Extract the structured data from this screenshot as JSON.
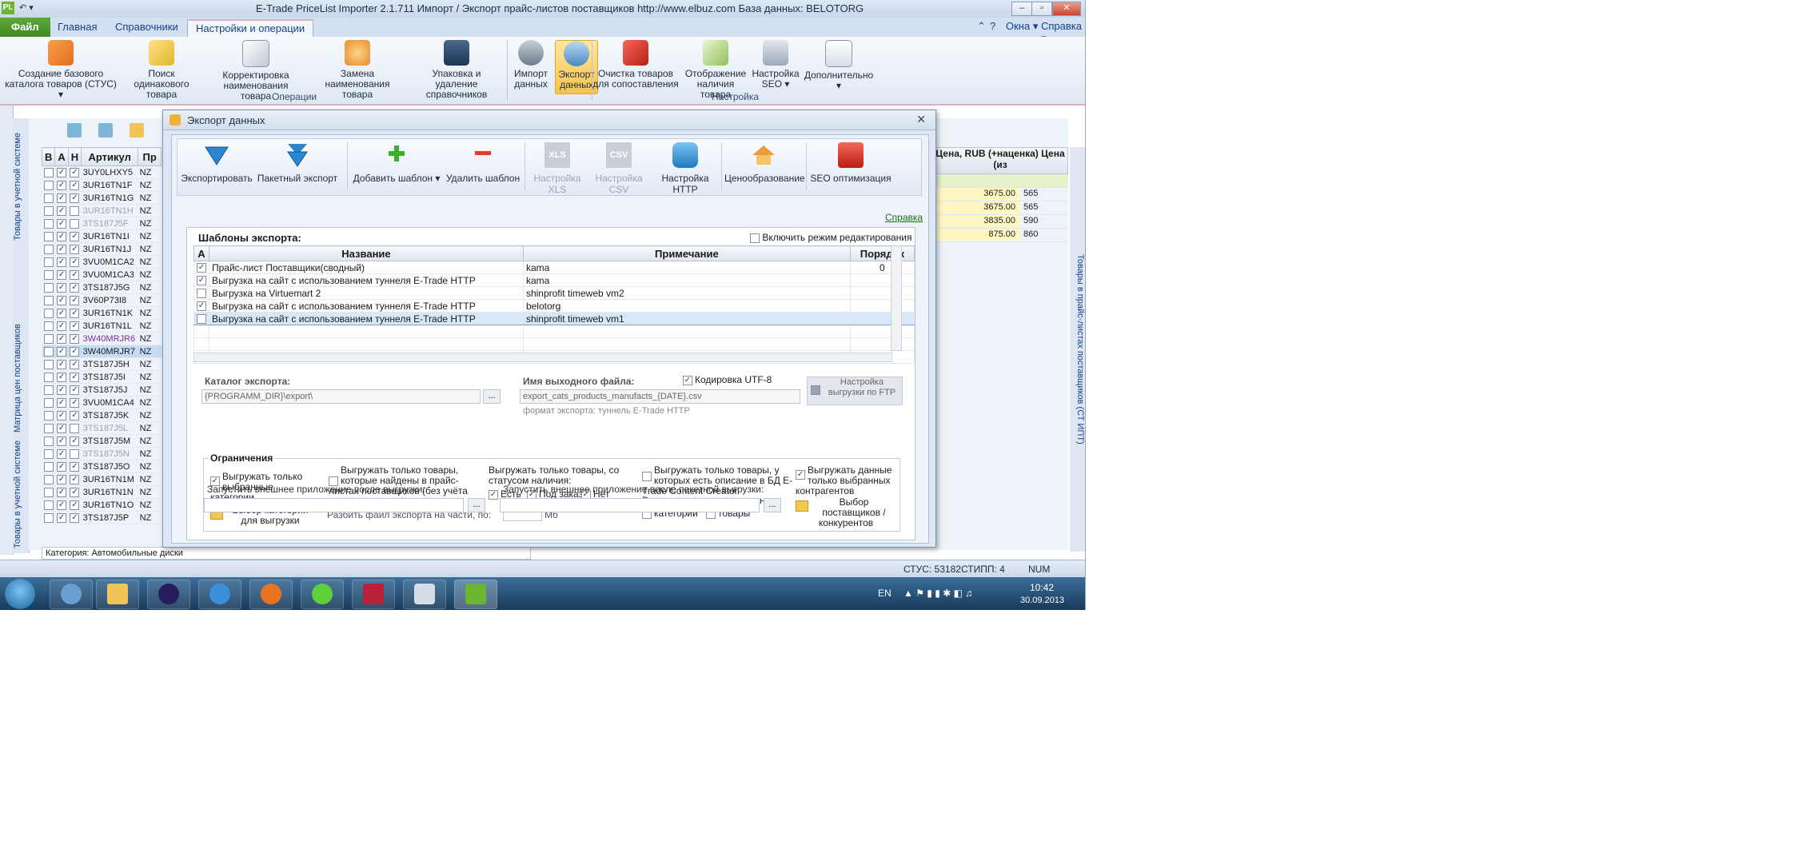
{
  "window": {
    "quick_access": "↶ ▾",
    "title": "E-Trade PriceList Importer 2.1.711   Импорт / Экспорт прайс-листов поставщиков   http://www.elbuz.com   База данных: BELOTORG",
    "min": "–",
    "max": "▫",
    "close": "✕"
  },
  "ribbon_tabs": {
    "file": "Файл",
    "tabs": [
      "Главная",
      "Справочники",
      "Настройки и операции"
    ],
    "windows": "Окна ▾",
    "help": "Справка ▾"
  },
  "ribbon": {
    "buttons": [
      {
        "label": "Создание базового каталога товаров (СТУС) ▾",
        "icon": "cubes-icon"
      },
      {
        "label": "Поиск одинакового товара",
        "icon": "search-product-icon"
      },
      {
        "label": "Корректировка наименования товара",
        "icon": "edit-name-icon"
      },
      {
        "label": "Замена наименования товара",
        "icon": "replace-icon"
      },
      {
        "label": "Упаковка и удаление справочников",
        "icon": "database-pack-icon"
      },
      {
        "label": "Импорт данных",
        "icon": "import-icon"
      },
      {
        "label": "Экспорт данных",
        "icon": "export-icon"
      },
      {
        "label": "Очистка товаров для сопоставления",
        "icon": "clean-icon"
      },
      {
        "label": "Отображение наличия товара",
        "icon": "availability-icon"
      },
      {
        "label": "Настройка SEO ▾",
        "icon": "seo-icon"
      },
      {
        "label": "Дополнительно ▾",
        "icon": "more-icon"
      }
    ],
    "groups": [
      "Операции",
      "Настройка"
    ]
  },
  "vertical_tabs": [
    "Товары в учетной системе",
    "Матрица цен поставщиков",
    "Товары в учетной системе"
  ],
  "right_vertical_tab": "Товары в прайс-листах поставщиков (СТ ИПТ)",
  "main_grid": {
    "headers": [
      "В",
      "А",
      "Н",
      "Артикул",
      "Пр"
    ],
    "rows": [
      {
        "art": "3UY0LHXY5",
        "pr": "NZ",
        "v": false,
        "a": true,
        "n": true,
        "style": ""
      },
      {
        "art": "3UR16TN1F",
        "pr": "NZ",
        "v": false,
        "a": true,
        "n": true,
        "style": ""
      },
      {
        "art": "3UR16TN1G",
        "pr": "NZ",
        "v": false,
        "a": true,
        "n": true,
        "style": ""
      },
      {
        "art": "3UR16TN1H",
        "pr": "NZ",
        "v": false,
        "a": true,
        "n": false,
        "style": "grey"
      },
      {
        "art": "3TS187J5F",
        "pr": "NZ",
        "v": false,
        "a": true,
        "n": false,
        "style": "grey"
      },
      {
        "art": "3UR16TN1I",
        "pr": "NZ",
        "v": false,
        "a": true,
        "n": true,
        "style": ""
      },
      {
        "art": "3UR16TN1J",
        "pr": "NZ",
        "v": false,
        "a": true,
        "n": true,
        "style": ""
      },
      {
        "art": "3VU0M1CA2",
        "pr": "NZ",
        "v": false,
        "a": true,
        "n": true,
        "style": ""
      },
      {
        "art": "3VU0M1CA3",
        "pr": "NZ",
        "v": false,
        "a": true,
        "n": true,
        "style": ""
      },
      {
        "art": "3TS187J5G",
        "pr": "NZ",
        "v": false,
        "a": true,
        "n": true,
        "style": ""
      },
      {
        "art": "3V60P73I8",
        "pr": "NZ",
        "v": false,
        "a": true,
        "n": true,
        "style": ""
      },
      {
        "art": "3UR16TN1K",
        "pr": "NZ",
        "v": false,
        "a": true,
        "n": true,
        "style": ""
      },
      {
        "art": "3UR16TN1L",
        "pr": "NZ",
        "v": false,
        "a": true,
        "n": true,
        "style": ""
      },
      {
        "art": "3W40MRJR6",
        "pr": "NZ",
        "v": false,
        "a": true,
        "n": true,
        "style": "purple"
      },
      {
        "art": "3W40MRJR7",
        "pr": "NZ",
        "v": false,
        "a": true,
        "n": true,
        "style": "sel"
      },
      {
        "art": "3TS187J5H",
        "pr": "NZ",
        "v": false,
        "a": true,
        "n": true,
        "style": ""
      },
      {
        "art": "3TS187J5I",
        "pr": "NZ",
        "v": false,
        "a": true,
        "n": true,
        "style": ""
      },
      {
        "art": "3TS187J5J",
        "pr": "NZ",
        "v": false,
        "a": true,
        "n": true,
        "style": ""
      },
      {
        "art": "3VU0M1CA4",
        "pr": "NZ",
        "v": false,
        "a": true,
        "n": true,
        "style": ""
      },
      {
        "art": "3TS187J5K",
        "pr": "NZ",
        "v": false,
        "a": true,
        "n": true,
        "style": ""
      },
      {
        "art": "3TS187J5L",
        "pr": "NZ",
        "v": false,
        "a": true,
        "n": false,
        "style": "grey"
      },
      {
        "art": "3TS187J5M",
        "pr": "NZ",
        "v": false,
        "a": true,
        "n": true,
        "style": ""
      },
      {
        "art": "3TS187J5N",
        "pr": "NZ",
        "v": false,
        "a": true,
        "n": false,
        "style": "grey"
      },
      {
        "art": "3TS187J5O",
        "pr": "NZ",
        "v": false,
        "a": true,
        "n": true,
        "style": ""
      },
      {
        "art": "3UR16TN1M",
        "pr": "NZ",
        "v": false,
        "a": true,
        "n": true,
        "style": ""
      },
      {
        "art": "3UR16TN1N",
        "pr": "NZ",
        "v": false,
        "a": true,
        "n": true,
        "style": ""
      },
      {
        "art": "3UR16TN1O",
        "pr": "NZ",
        "v": false,
        "a": true,
        "n": true,
        "style": ""
      },
      {
        "art": "3TS187J5P",
        "pr": "NZ",
        "v": false,
        "a": true,
        "n": true,
        "style": ""
      }
    ]
  },
  "right_grid": {
    "header1": "Цена, RUB (+наценка)",
    "header2": "Цена (из",
    "rows": [
      {
        "p": "",
        "q": ""
      },
      {
        "p": "3675.00",
        "q": "565"
      },
      {
        "p": "3675.00",
        "q": "565"
      },
      {
        "p": "3835.00",
        "q": "590"
      },
      {
        "p": "875.00",
        "q": "860"
      }
    ]
  },
  "category_bar": "Категория: Автомобильные диски",
  "statusbar": {
    "stus": "СТУС: 53182",
    "stipp": "СТИПП: 4",
    "num": "NUM"
  },
  "taskbar": {
    "lang": "EN",
    "time": "10:42",
    "date": "30.09.2013"
  },
  "dialog": {
    "title": "Экспорт данных",
    "close": "✕",
    "toolbar": [
      {
        "label": "Экспортировать",
        "disabled": false
      },
      {
        "label": "Пакетный экспорт",
        "disabled": false
      },
      {
        "label": "Добавить шаблон ▾",
        "disabled": false
      },
      {
        "label": "Удалить шаблон",
        "disabled": false
      },
      {
        "label": "Настройка XLS",
        "disabled": true
      },
      {
        "label": "Настройка CSV",
        "disabled": true
      },
      {
        "label": "Настройка HTTP",
        "disabled": false
      },
      {
        "label": "Ценообразование",
        "disabled": false
      },
      {
        "label": "SEO оптимизация",
        "disabled": false
      }
    ],
    "xls_tag": "XLS",
    "csv_tag": "CSV",
    "help": "Справка",
    "templates_title": "Шаблоны экспорта:",
    "edit_mode": "Включить режим редактирования",
    "table_headers": [
      "А",
      "Название",
      "Примечание",
      "Порядок"
    ],
    "templates": [
      {
        "checked": true,
        "name": "Прайс-лист Поставщики(сводный)",
        "note": "kama",
        "order": "0",
        "selected": false
      },
      {
        "checked": true,
        "name": "Выгрузка на сайт с использованием туннеля E-Trade HTTP",
        "note": "kama",
        "order": "",
        "selected": false
      },
      {
        "checked": false,
        "name": "Выгрузка на Virtuemart 2",
        "note": "shinprofit timeweb  vm2",
        "order": "",
        "selected": false
      },
      {
        "checked": true,
        "name": "Выгрузка на сайт с использованием туннеля E-Trade HTTP",
        "note": "belotorg",
        "order": "",
        "selected": false
      },
      {
        "checked": false,
        "name": "Выгрузка на сайт с использованием туннеля E-Trade HTTP",
        "note": "shinprofit  timeweb  vm1",
        "order": "",
        "selected": true
      }
    ],
    "catalog_label": "Каталог экспорта:",
    "catalog_value": "{PROGRAMM_DIR}\\export\\",
    "output_label": "Имя выходного файла:",
    "output_value": "export_cats_products_manufacts_{DATE}.csv",
    "utf8": "Кодировка UTF-8",
    "ftp": "Настройка выгрузки по FTP",
    "format_hint": "формат экспорта: туннель E-Trade HTTP",
    "restrictions_title": "Ограничения",
    "opt_selected_categories": "Выгружать только выбранные категории",
    "opt_found_in_pricelists": "Выгружать только товары, которые найдены в прайс-листах поставщиков (без учёта статуса наличия)",
    "opt_status_title": "Выгружать только товары, со статусом наличия:",
    "status_yes": "Есть",
    "status_order": "Под заказ",
    "status_no": "Нет",
    "opt_content_creator": "Выгружать только товары, у которых есть описание в БД E-Trade Content Creator",
    "opt_deactivated_title": "Выгружать деактивированные:",
    "deact_categories": "категории",
    "deact_products": "товары",
    "opt_selected_contractors": "Выгружать данные только выбранных контрагентов",
    "choose_categories": "Выбор категорий для выгрузки",
    "split_label": "Разбить файл экспорта на части, по:",
    "split_unit": "Мб",
    "choose_suppliers": "Выбор поставщиков / конкурентов",
    "run_after_label": "Запустить внешнее приложение после выгрузки:",
    "run_after_batch_label": "Запустить внешнее приложение после пакетной выгрузки:",
    "dots": "..."
  }
}
